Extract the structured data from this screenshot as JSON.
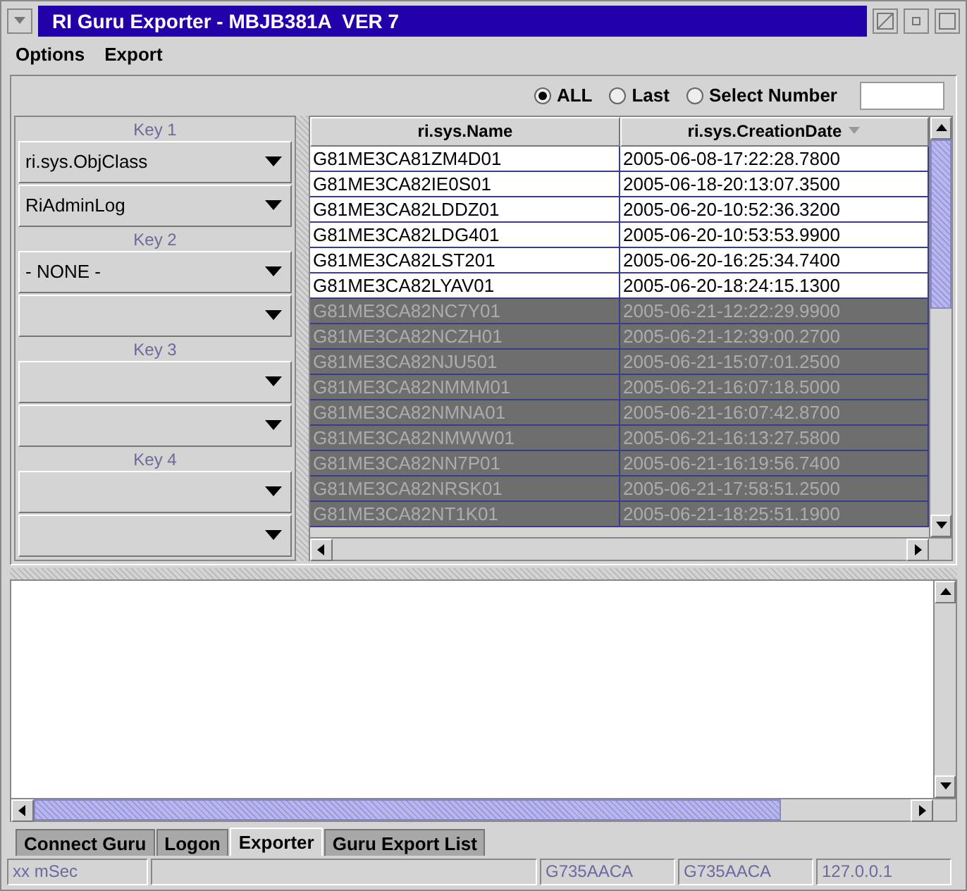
{
  "window": {
    "title": "RI Guru Exporter - MBJB381A  VER 7"
  },
  "menu": [
    "Options",
    "Export"
  ],
  "filter": {
    "options": [
      {
        "label": "ALL",
        "selected": true
      },
      {
        "label": "Last",
        "selected": false
      },
      {
        "label": "Select Number",
        "selected": false
      }
    ]
  },
  "keys": [
    {
      "label": "Key 1",
      "dropdowns": [
        {
          "kind": "dropdown",
          "value": "ri.sys.ObjClass"
        },
        {
          "kind": "dropdown",
          "value": "RiAdminLog"
        }
      ]
    },
    {
      "label": "Key 2",
      "dropdowns": [
        {
          "kind": "dropdown",
          "value": "- NONE -"
        },
        {
          "kind": "dropdown"
        }
      ]
    },
    {
      "label": "Key 3",
      "dropdowns": [
        {
          "kind": "dropdown"
        },
        {
          "kind": "dropdown"
        }
      ]
    },
    {
      "label": "Key 4",
      "dropdowns": [
        {
          "kind": "dropdown"
        },
        {
          "kind": "dropdown"
        }
      ]
    }
  ],
  "table": {
    "columns": [
      {
        "label": "ri.sys.Name",
        "sorted": false
      },
      {
        "label": "ri.sys.CreationDate",
        "sorted": true
      }
    ],
    "rows": [
      {
        "cells": [
          "G81ME3CA81ZM4D01",
          "2005-06-08-17:22:28.7800"
        ],
        "selected": false
      },
      {
        "cells": [
          "G81ME3CA82IE0S01",
          "2005-06-18-20:13:07.3500"
        ],
        "selected": false
      },
      {
        "cells": [
          "G81ME3CA82LDDZ01",
          "2005-06-20-10:52:36.3200"
        ],
        "selected": false
      },
      {
        "cells": [
          "G81ME3CA82LDG401",
          "2005-06-20-10:53:53.9900"
        ],
        "selected": false
      },
      {
        "cells": [
          "G81ME3CA82LST201",
          "2005-06-20-16:25:34.7400"
        ],
        "selected": false
      },
      {
        "cells": [
          "G81ME3CA82LYAV01",
          "2005-06-20-18:24:15.1300"
        ],
        "selected": false
      },
      {
        "cells": [
          "G81ME3CA82NC7Y01",
          "2005-06-21-12:22:29.9900"
        ],
        "selected": true
      },
      {
        "cells": [
          "G81ME3CA82NCZH01",
          "2005-06-21-12:39:00.2700"
        ],
        "selected": true
      },
      {
        "cells": [
          "G81ME3CA82NJU501",
          "2005-06-21-15:07:01.2500"
        ],
        "selected": true
      },
      {
        "cells": [
          "G81ME3CA82NMMM01",
          "2005-06-21-16:07:18.5000"
        ],
        "selected": true
      },
      {
        "cells": [
          "G81ME3CA82NMNA01",
          "2005-06-21-16:07:42.8700"
        ],
        "selected": true
      },
      {
        "cells": [
          "G81ME3CA82NMWW01",
          "2005-06-21-16:13:27.5800"
        ],
        "selected": true
      },
      {
        "cells": [
          "G81ME3CA82NN7P01",
          "2005-06-21-16:19:56.7400"
        ],
        "selected": true
      },
      {
        "cells": [
          "G81ME3CA82NRSK01",
          "2005-06-21-17:58:51.2500"
        ],
        "selected": true
      },
      {
        "cells": [
          "G81ME3CA82NT1K01",
          "2005-06-21-18:25:51.1900"
        ],
        "selected": true
      }
    ]
  },
  "tabs": [
    {
      "label": "Connect Guru",
      "selected": false
    },
    {
      "label": "Logon",
      "selected": false
    },
    {
      "label": "Exporter",
      "selected": true
    },
    {
      "label": "Guru Export List",
      "selected": false
    }
  ],
  "status_bar": [
    {
      "kind": "field",
      "text": "xx mSec"
    },
    {
      "kind": "field"
    },
    {
      "kind": "field",
      "text": "G735AACA"
    },
    {
      "kind": "field",
      "text": "G735AACA"
    },
    {
      "kind": "field",
      "text": "127.0.0.1"
    }
  ]
}
